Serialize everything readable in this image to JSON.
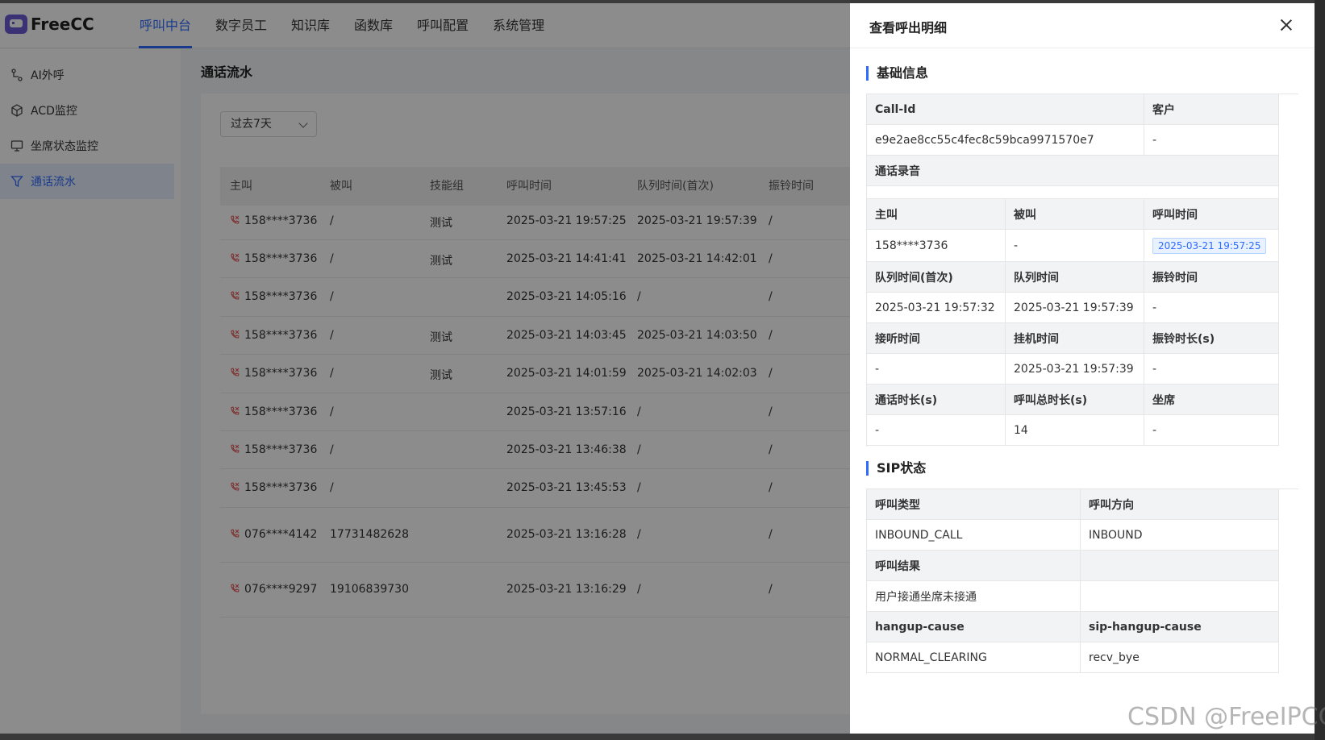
{
  "logo": {
    "text": "FreeCC"
  },
  "nav": [
    {
      "label": "呼叫中台",
      "active": true
    },
    {
      "label": "数字员工"
    },
    {
      "label": "知识库"
    },
    {
      "label": "函数库"
    },
    {
      "label": "呼叫配置"
    },
    {
      "label": "系统管理"
    }
  ],
  "sidebar": [
    {
      "label": "AI外呼",
      "icon": "flow-icon"
    },
    {
      "label": "ACD监控",
      "icon": "cube-icon"
    },
    {
      "label": "坐席状态监控",
      "icon": "monitor-icon"
    },
    {
      "label": "通话流水",
      "icon": "filter-icon",
      "active": true
    }
  ],
  "page_title": "通话流水",
  "filter": {
    "value": "过去7天"
  },
  "table": {
    "headers": [
      "主叫",
      "被叫",
      "技能组",
      "呼叫时间",
      "队列时间(首次)",
      "振铃时间"
    ],
    "rows": [
      [
        "158****3736",
        "/",
        "测试",
        "2025-03-21 19:57:25",
        "2025-03-21 19:57:39",
        "/"
      ],
      [
        "158****3736",
        "/",
        "测试",
        "2025-03-21 14:41:41",
        "2025-03-21 14:42:01",
        "/"
      ],
      [
        "158****3736",
        "/",
        "",
        "2025-03-21 14:05:16",
        "/",
        "/"
      ],
      [
        "158****3736",
        "/",
        "测试",
        "2025-03-21 14:03:45",
        "2025-03-21 14:03:50",
        "/"
      ],
      [
        "158****3736",
        "/",
        "测试",
        "2025-03-21 14:01:59",
        "2025-03-21 14:02:03",
        "/"
      ],
      [
        "158****3736",
        "/",
        "",
        "2025-03-21 13:57:16",
        "/",
        "/"
      ],
      [
        "158****3736",
        "/",
        "",
        "2025-03-21 13:46:38",
        "/",
        "/"
      ],
      [
        "158****3736",
        "/",
        "",
        "2025-03-21 13:45:53",
        "/",
        "/"
      ],
      [
        "076****4142",
        "17731482628",
        "",
        "2025-03-21 13:16:28",
        "/",
        "/"
      ],
      [
        "076****9297",
        "19106839730",
        "",
        "2025-03-21 13:16:29",
        "/",
        "/"
      ]
    ]
  },
  "drawer": {
    "title": "查看呼出明细",
    "basic_title": "基础信息",
    "basic": {
      "call_id_label": "Call-Id",
      "customer_label": "客户",
      "call_id": "e9e2ae8cc55c4fec8c59bca9971570e7",
      "customer": "-",
      "recording_label": "通话录音",
      "caller_label": "主叫",
      "callee_label": "被叫",
      "call_time_label": "呼叫时间",
      "caller": "158****3736",
      "callee": "-",
      "call_time": "2025-03-21 19:57:25",
      "queue_first_label": "队列时间(首次)",
      "queue_label": "队列时间",
      "ring_label": "振铃时间",
      "queue_first": "2025-03-21 19:57:32",
      "queue": "2025-03-21 19:57:39",
      "ring": "-",
      "answer_label": "接听时间",
      "hangup_label": "挂机时间",
      "ring_dur_label": "振铃时长(s)",
      "answer": "-",
      "hangup": "2025-03-21 19:57:39",
      "ring_dur": "-",
      "talk_dur_label": "通话时长(s)",
      "total_dur_label": "呼叫总时长(s)",
      "agent_label": "坐席",
      "talk_dur": "-",
      "total_dur": "14",
      "agent": "-"
    },
    "sip_title": "SIP状态",
    "sip": {
      "call_type_label": "呼叫类型",
      "direction_label": "呼叫方向",
      "call_type": "INBOUND_CALL",
      "direction": "INBOUND",
      "result_label": "呼叫结果",
      "result": "用户接通坐席未接通",
      "hangup_cause_label": "hangup-cause",
      "sip_hangup_cause_label": "sip-hangup-cause",
      "hangup_cause": "NORMAL_CLEARING",
      "sip_hangup_cause": "recv_bye"
    }
  },
  "watermark": "CSDN @FreeIPCC",
  "colors": {
    "accent": "#2f6bff",
    "phone": "#e34d4d"
  }
}
